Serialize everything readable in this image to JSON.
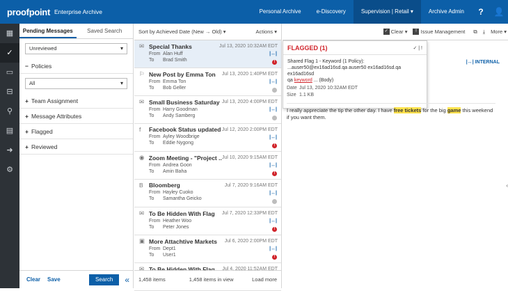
{
  "app": {
    "brand": "proofpoint",
    "title": "Enterprise Archive"
  },
  "topnav": {
    "personal_archive": "Personal Archive",
    "ediscovery": "e-Discovery",
    "supervision": "Supervision | Retail ▾",
    "archive_admin": "Archive Admin",
    "help": "?",
    "user": "👤"
  },
  "rail": {
    "icons": [
      "grid-icon",
      "check-icon",
      "calendar-icon",
      "inbox-icon",
      "search-icon",
      "clipboard-icon",
      "export-icon",
      "gear-icon"
    ]
  },
  "filters": {
    "tab_pending": "Pending Messages",
    "tab_saved": "Saved Search",
    "status_select": "Unreviewed",
    "policies": "Policies",
    "policy_select": "All",
    "team_assignment": "Team Assignment",
    "message_attributes": "Message Attributes",
    "flagged": "Flagged",
    "reviewed": "Reviewed",
    "clear": "Clear",
    "save": "Save",
    "search": "Search",
    "collapse": "«"
  },
  "list": {
    "sort": "Sort by Achieved Date (New → Old) ▾",
    "actions": "Actions ▾",
    "from_label": "From",
    "to_label": "To",
    "items_count": "1,458 items",
    "items_in_view": "1,458 items in view",
    "load_more": "Load more",
    "messages": [
      {
        "icon": "✉",
        "subject": "Special Thanks",
        "date": "Jul 13, 2020 10:32AM EDT",
        "from": "Alan Huff",
        "to": "Brad Smith",
        "status": "red"
      },
      {
        "icon": "⚐",
        "subject": "New Post by Emma Ton",
        "date": "Jul 13, 2020 1:40PM EDT",
        "from": "Emma Ton",
        "to": "Bob Geller",
        "status": "grey"
      },
      {
        "icon": "✉",
        "subject": "Small Business Saturday",
        "date": "Jul 13, 2020 4:00PM EDT",
        "from": "Harry Goodman",
        "to": "Andy Samberg",
        "status": "grey"
      },
      {
        "icon": "f",
        "subject": "Facebook Status updated",
        "date": "Jul 12, 2020 2:00PM EDT",
        "from": "Ayley Woodbrige",
        "to": "Eddie Nygong",
        "status": "red"
      },
      {
        "icon": "◉",
        "subject": "Zoom Meeting - \"Project ...",
        "date": "Jul 10, 2020 9:15AM EDT",
        "from": "Andrea Goon",
        "to": "Amin Baha",
        "status": "red"
      },
      {
        "icon": "B",
        "subject": "Bloomberg",
        "date": "Jul 7, 2020 9:16AM EDT",
        "from": "Hayley Cuoko",
        "to": "Samantha Geicko",
        "status": "grey"
      },
      {
        "icon": "✉",
        "subject": "To Be Hidden With Flag",
        "date": "Jul 7, 2020 12:33PM EDT",
        "from": "Heather Woo",
        "to": "Peter Jones",
        "status": "red"
      },
      {
        "icon": "▣",
        "subject": "More Attachtive Markets",
        "date": "Jul 6, 2020 2:00PM EDT",
        "from": "Dept1",
        "to": "User1",
        "status": "red"
      },
      {
        "icon": "✉",
        "subject": "To Be Hidden With Flag",
        "date": "Jul 4, 2020 11:52AM EDT",
        "from": "",
        "to": "",
        "status": ""
      }
    ]
  },
  "detail": {
    "clear": "Clear ▾",
    "issue_management": "Issue Management",
    "more": "More ▾",
    "flagged_title": "FLAGGED (1)",
    "flag_line1": "Shared Flag 1 - Keyword (1 Policy):",
    "flag_line2": "...auser50@ex16ad16sd.qa auser50 ex16ad16sd.qa ex16ad16sd",
    "flag_pre": "qa ",
    "flag_keyword": "keyword",
    "flag_post": " ... (Body)",
    "internal": "|↔| INTERNAL",
    "date_label": "Date",
    "date_value": "Jul 13, 2020 10:32AM EDT",
    "size_label": "Size",
    "size_value": "1.1 KB",
    "body_1": "I really appreciate the tip the other day.  I have ",
    "body_hl1": "free tickets",
    "body_2": " for the big ",
    "body_hl2": "game",
    "body_3": " this weekend if you want them."
  }
}
